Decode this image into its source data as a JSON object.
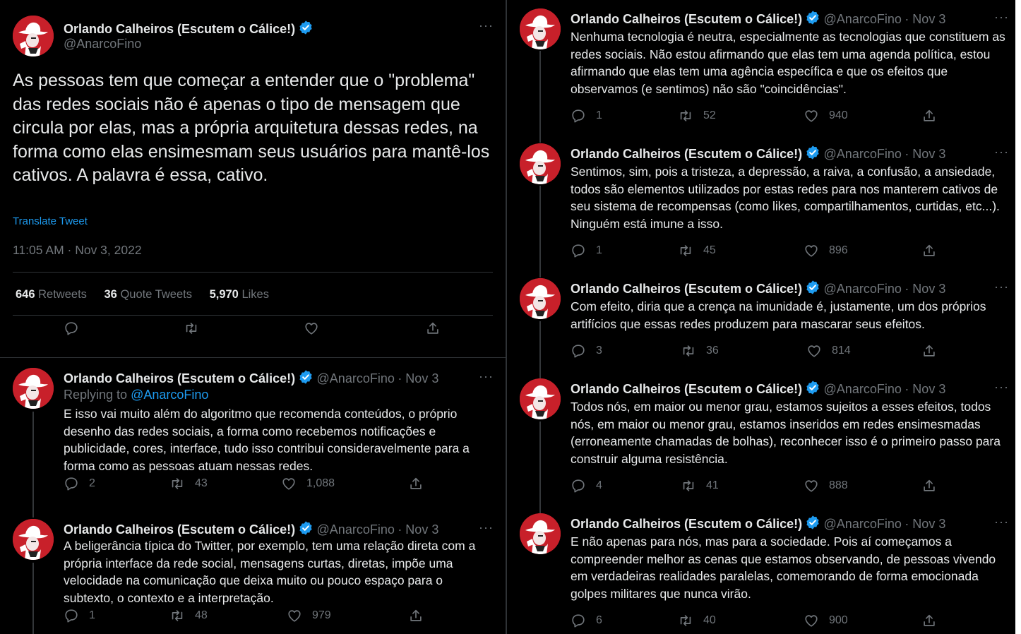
{
  "colors": {
    "background": "#000000",
    "text": "#e7e9ea",
    "muted": "#71767b",
    "link": "#1d9bf0",
    "verified": "#1d9bf0",
    "avatar": "#c8202a"
  },
  "author": {
    "name": "Orlando Calheiros (Escutem o Cálice!)",
    "handle": "@AnarcoFino"
  },
  "main_tweet": {
    "text": "As pessoas tem que começar a entender que o \"problema\" das redes sociais não é apenas o tipo de mensagem que circula por elas, mas a própria arquitetura dessas redes, na forma como elas ensimesmam seus usuários para mantê-los cativos. A palavra é essa, cativo.",
    "translate": "Translate Tweet",
    "timestamp": "11:05 AM · Nov 3, 2022",
    "stats": {
      "retweets": "646",
      "retweets_label": "Retweets",
      "quotes": "36",
      "quotes_label": "Quote Tweets",
      "likes": "5,970",
      "likes_label": "Likes"
    }
  },
  "left_replies": [
    {
      "date": "· Nov 3",
      "replying_prefix": "Replying to",
      "replying_to": "@AnarcoFino",
      "text": "E isso vai muito além do algoritmo que recomenda conteúdos, o próprio desenho das redes sociais, a forma como recebemos notificações e publicidade, cores, interface, tudo isso contribui consideravelmente para a forma como as pessoas atuam nessas redes.",
      "replies": "2",
      "retweets": "43",
      "likes": "1,088"
    },
    {
      "date": "· Nov 3",
      "text": "A beligerância típica do Twitter, por exemplo, tem uma relação direta com a própria interface da rede social, mensagens curtas, diretas, impõe uma velocidade na comunicação que deixa muito ou pouco espaço para o subtexto, o contexto e a interpretação.",
      "replies": "1",
      "retweets": "48",
      "likes": "979"
    }
  ],
  "right_tweets": [
    {
      "date": "· Nov 3",
      "text": "Nenhuma tecnologia é neutra, especialmente as tecnologias que constituem as redes sociais. Não estou afirmando que elas tem uma agenda política, estou afirmando que elas tem uma agência específica e que os efeitos que observamos (e sentimos) não são \"coincidências\".",
      "replies": "1",
      "retweets": "52",
      "likes": "940"
    },
    {
      "date": "· Nov 3",
      "text": "Sentimos, sim, pois a tristeza, a depressão, a raiva, a confusão, a ansiedade, todos são elementos utilizados por estas redes para nos manterem cativos de seu sistema de recompensas (como likes, compartilhamentos, curtidas, etc...). Ninguém está imune a isso.",
      "replies": "1",
      "retweets": "45",
      "likes": "896"
    },
    {
      "date": "· Nov 3",
      "text": "Com efeito, diria que a crença na imunidade é, justamente, um dos próprios artifícios que essas redes produzem para mascarar seus efeitos.",
      "replies": "3",
      "retweets": "36",
      "likes": "814"
    },
    {
      "date": "· Nov 3",
      "text": "Todos nós, em maior ou menor grau, estamos sujeitos a esses efeitos, todos nós, em maior ou menor grau, estamos inseridos em redes ensimesmadas (erroneamente chamadas de bolhas), reconhecer isso é o primeiro passo para construir alguma resistência.",
      "replies": "4",
      "retweets": "41",
      "likes": "888"
    },
    {
      "date": "· Nov 3",
      "text": "E não apenas para nós, mas para a sociedade. Pois aí começamos a compreender melhor as cenas que estamos observando, de pessoas vivendo em verdadeiras realidades paralelas, comemorando de forma emocionada golpes militares que nunca virão.",
      "replies": "6",
      "retweets": "40",
      "likes": "900"
    }
  ]
}
